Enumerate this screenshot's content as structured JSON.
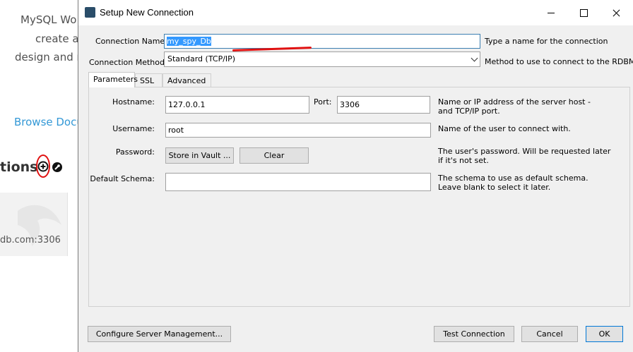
{
  "background": {
    "welcome_line1": "MySQL Wo",
    "welcome_line2": "create a",
    "welcome_line3": "design and r",
    "browse_link": "Browse Docu",
    "connections_heading": "tions",
    "add_connection_icon": "plus-circle-icon",
    "manage_connections_icon": "wrench-icon",
    "tile_text": "db.com:3306"
  },
  "dialog": {
    "title": "Setup New Connection",
    "connection_name": {
      "label": "Connection Name:",
      "value": "my_spy_Db",
      "help": "Type a name for the connection"
    },
    "connection_method": {
      "label": "Connection Method:",
      "value": "Standard (TCP/IP)",
      "help": "Method to use to connect to the RDBMS"
    },
    "tabs": [
      "Parameters",
      "SSL",
      "Advanced"
    ],
    "parameters": {
      "hostname_label": "Hostname:",
      "hostname_value": "127.0.0.1",
      "port_label": "Port:",
      "port_value": "3306",
      "hostname_help": "Name or IP address of the server host - and TCP/IP port.",
      "username_label": "Username:",
      "username_value": "root",
      "username_help": "Name of the user to connect with.",
      "password_label": "Password:",
      "store_vault_button": "Store in Vault ...",
      "clear_button": "Clear",
      "password_help": "The user's password. Will be requested later if it's not set.",
      "schema_label": "Default Schema:",
      "schema_value": "",
      "schema_help": "The schema to use as default schema. Leave blank to select it later."
    },
    "buttons": {
      "configure": "Configure Server Management...",
      "test": "Test Connection",
      "cancel": "Cancel",
      "ok": "OK"
    }
  }
}
